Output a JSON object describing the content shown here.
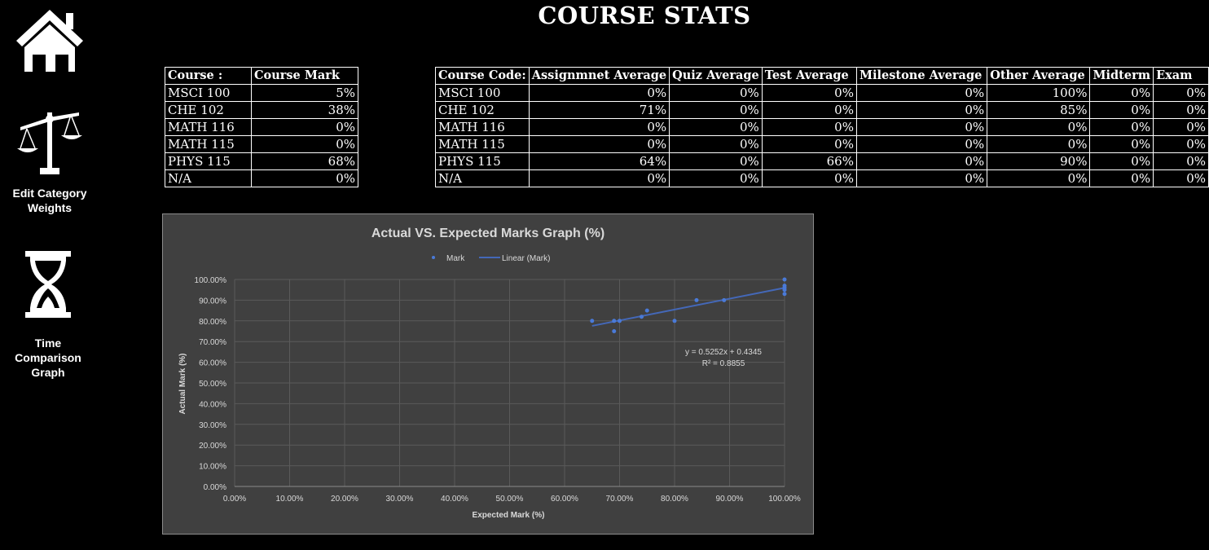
{
  "page": {
    "title": "COURSE STATS"
  },
  "nav": {
    "home_label": "",
    "weights_label_line1": "Edit Category",
    "weights_label_line2": "Weights",
    "time_label_line1": "Time",
    "time_label_line2": "Comparison",
    "time_label_line3": "Graph"
  },
  "marks_table": {
    "headers": [
      "Course :",
      "Course Mark"
    ],
    "rows": [
      [
        "MSCI 100",
        "5%"
      ],
      [
        "CHE 102",
        "38%"
      ],
      [
        "MATH 116",
        "0%"
      ],
      [
        "MATH 115",
        "0%"
      ],
      [
        "PHYS 115",
        "68%"
      ],
      [
        "N/A",
        "0%"
      ]
    ]
  },
  "averages_table": {
    "headers": [
      "Course Code:",
      "Assignmnet Average",
      "Quiz Average",
      "Test Average",
      "Milestone Average",
      "Other Average",
      "Midterm",
      "Exam"
    ],
    "rows": [
      [
        "MSCI 100",
        "0%",
        "0%",
        "0%",
        "0%",
        "100%",
        "0%",
        "0%"
      ],
      [
        "CHE 102",
        "71%",
        "0%",
        "0%",
        "0%",
        "85%",
        "0%",
        "0%"
      ],
      [
        "MATH 116",
        "0%",
        "0%",
        "0%",
        "0%",
        "0%",
        "0%",
        "0%"
      ],
      [
        "MATH 115",
        "0%",
        "0%",
        "0%",
        "0%",
        "0%",
        "0%",
        "0%"
      ],
      [
        "PHYS 115",
        "64%",
        "0%",
        "66%",
        "0%",
        "90%",
        "0%",
        "0%"
      ],
      [
        "N/A",
        "0%",
        "0%",
        "0%",
        "0%",
        "0%",
        "0%",
        "0%"
      ]
    ]
  },
  "colors": {
    "background": "#000000",
    "chart_bg": "#404040",
    "series": "#4a7ad8",
    "trend": "#4468b8"
  },
  "chart_data": {
    "type": "scatter",
    "title": "Actual VS. Expected Marks Graph (%)",
    "xlabel": "Expected Mark (%)",
    "ylabel": "Actual Mark (%)",
    "xlim": [
      0,
      1
    ],
    "ylim": [
      0,
      1
    ],
    "xticks": [
      "0.00%",
      "10.00%",
      "20.00%",
      "30.00%",
      "40.00%",
      "50.00%",
      "60.00%",
      "70.00%",
      "80.00%",
      "90.00%",
      "100.00%"
    ],
    "yticks": [
      "0.00%",
      "10.00%",
      "20.00%",
      "30.00%",
      "40.00%",
      "50.00%",
      "60.00%",
      "70.00%",
      "80.00%",
      "90.00%",
      "100.00%"
    ],
    "legend": [
      "Mark",
      "Linear (Mark)"
    ],
    "legend_position": "top",
    "grid": true,
    "series": [
      {
        "name": "Mark",
        "points": [
          [
            0.65,
            0.8
          ],
          [
            0.69,
            0.8
          ],
          [
            0.69,
            0.75
          ],
          [
            0.7,
            0.8
          ],
          [
            0.74,
            0.82
          ],
          [
            0.75,
            0.85
          ],
          [
            0.8,
            0.8
          ],
          [
            0.84,
            0.9
          ],
          [
            0.89,
            0.9
          ],
          [
            1.0,
            1.0
          ],
          [
            1.0,
            0.97
          ],
          [
            1.0,
            0.96
          ],
          [
            1.0,
            0.95
          ],
          [
            1.0,
            0.93
          ]
        ]
      }
    ],
    "trendline": {
      "name": "Linear (Mark)",
      "slope": 0.5252,
      "intercept": 0.4345,
      "x_range": [
        0.65,
        1.0
      ]
    },
    "annotations": [
      "y = 0.5252x + 0.4345",
      "R² = 0.8855"
    ]
  }
}
